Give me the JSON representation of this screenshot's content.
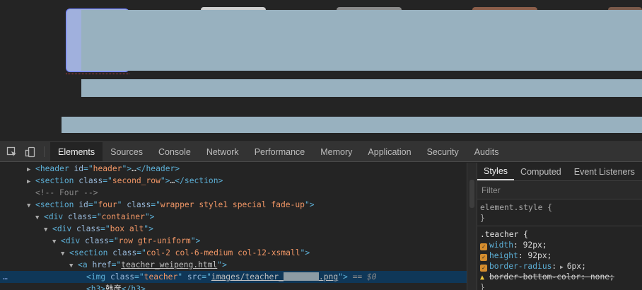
{
  "devtools": {
    "tabs": [
      {
        "label": "Elements",
        "active": true
      },
      {
        "label": "Sources"
      },
      {
        "label": "Console"
      },
      {
        "label": "Network"
      },
      {
        "label": "Performance"
      },
      {
        "label": "Memory"
      },
      {
        "label": "Application"
      },
      {
        "label": "Security"
      },
      {
        "label": "Audits"
      }
    ],
    "icons": [
      "inspect-element-icon",
      "device-toolbar-icon"
    ],
    "tree": {
      "header": {
        "tag": "header",
        "attr": "id",
        "val": "header",
        "ellipsis": "…",
        "close": "</header>"
      },
      "second_row": {
        "tag": "section",
        "attr": "class",
        "val": "second_row",
        "ellipsis": "…",
        "close": "</section>"
      },
      "comment": "<!-- Four -->",
      "four": {
        "tag": "section",
        "a1": "id",
        "v1": "four",
        "a2": "class",
        "v2": "wrapper style1 special fade-up"
      },
      "container": {
        "tag": "div",
        "attr": "class",
        "val": "container"
      },
      "box": {
        "tag": "div",
        "attr": "class",
        "val": "box alt"
      },
      "row": {
        "tag": "div",
        "attr": "class",
        "val": "row gtr-uniform"
      },
      "col": {
        "tag": "section",
        "attr": "class",
        "val": "col-2 col-6-medium col-12-xsmall"
      },
      "link": {
        "tag": "a",
        "attr": "href",
        "val": "teacher_weipeng.html"
      },
      "img": {
        "tag": "img",
        "a1": "class",
        "v1": "teacher",
        "a2": "src",
        "src_prefix": "images/teacher_",
        "src_suffix": ".png",
        "eq": "== $0"
      },
      "h3_text": "韩彦",
      "dots": "…"
    },
    "styles": {
      "subtabs": [
        {
          "label": "Styles",
          "active": true
        },
        {
          "label": "Computed"
        },
        {
          "label": "Event Listeners"
        }
      ],
      "filter_placeholder": "Filter",
      "element_style": {
        "selector": "element.style {",
        "close": "}"
      },
      "teacher_rule": {
        "selector": ".teacher {",
        "props": [
          {
            "name": "width",
            "value": "92px;"
          },
          {
            "name": "height",
            "value": "92px;"
          },
          {
            "name": "border-radius",
            "value": "6px;"
          },
          {
            "name": "border-bottom-color",
            "value": "none;"
          }
        ],
        "close": "}"
      }
    }
  },
  "colors": {
    "tag": "#5db0d7",
    "attr_value": "#f29766",
    "selected_row": "#0f3758",
    "checkbox": "#d58d2e",
    "mask": "#98b1bf"
  }
}
